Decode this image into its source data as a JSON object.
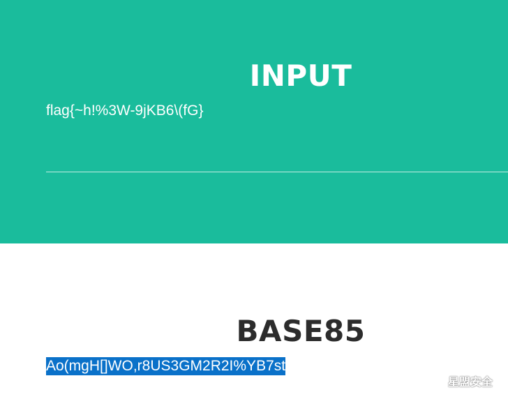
{
  "input_section": {
    "title": "INPUT",
    "text": "flag{~h!%3W-9jKB6\\(fG}"
  },
  "output_section": {
    "title": "BASE85",
    "text": "Ao(mgH[]WO,r8US3GM2R2I%YB7st"
  },
  "watermark": {
    "icon": "wechat-icon",
    "label": "星盟安全"
  },
  "colors": {
    "accent": "#1abc9c",
    "selection": "#0a71c9",
    "title_dark": "#2c2c2c"
  }
}
